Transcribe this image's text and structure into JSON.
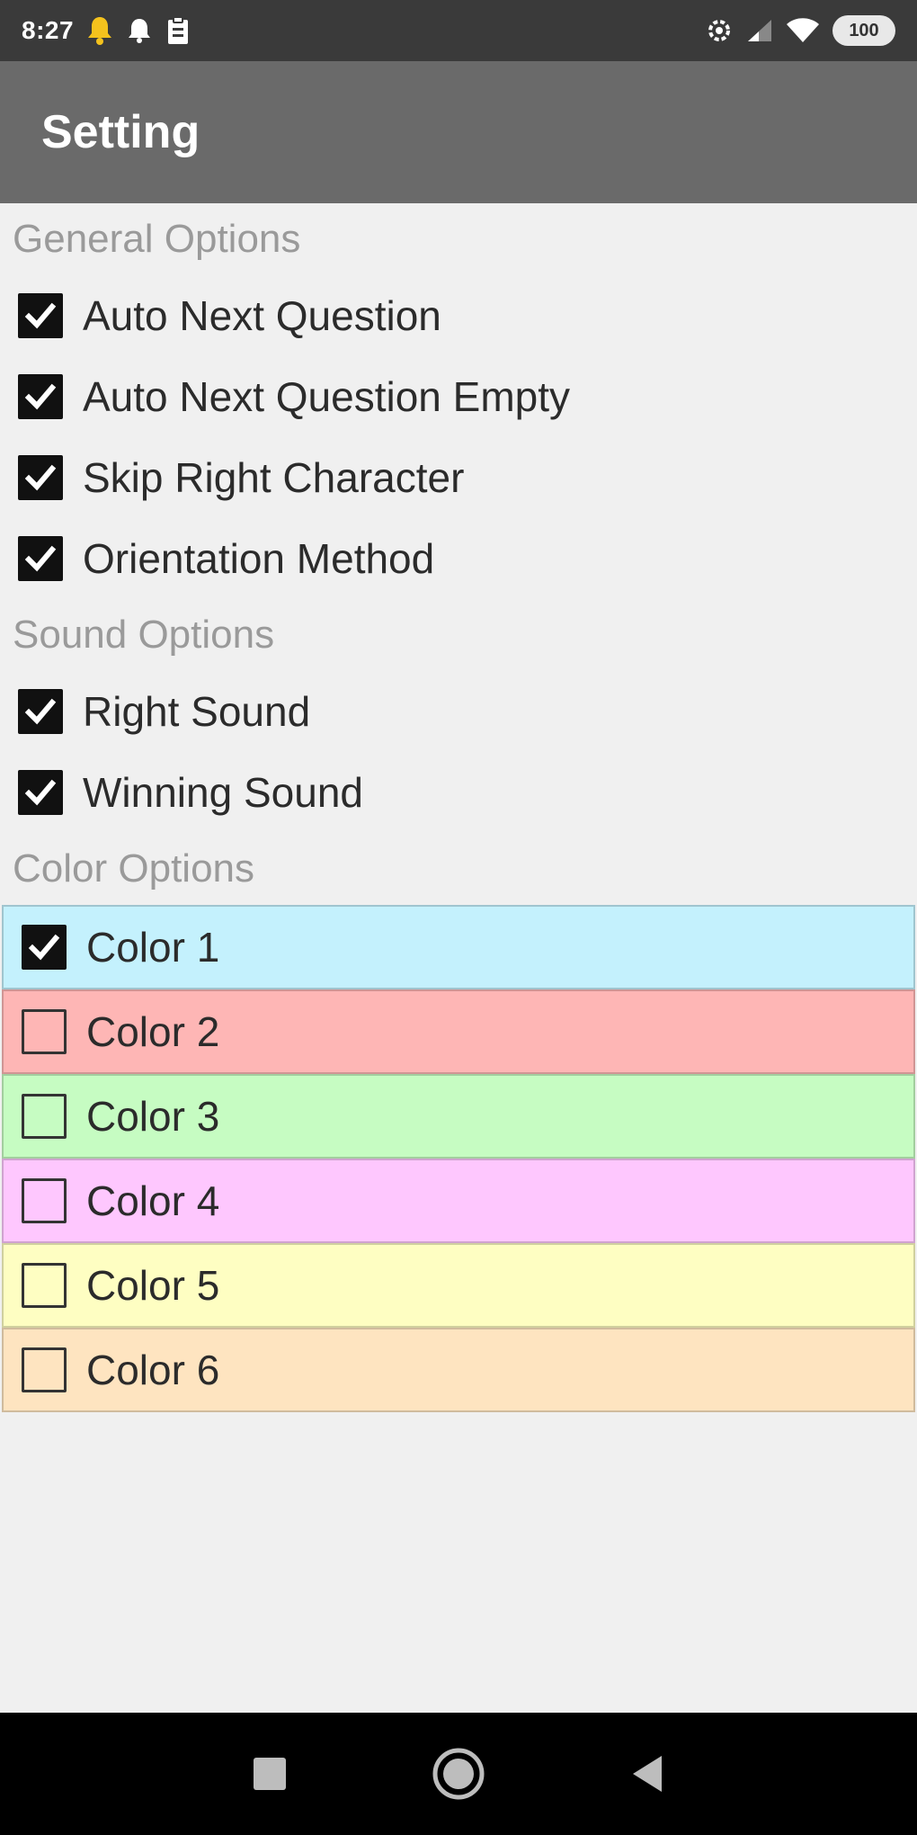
{
  "status_bar": {
    "time": "8:27",
    "battery": "100"
  },
  "app_bar": {
    "title": "Setting"
  },
  "sections": {
    "general": {
      "header": "General Options",
      "items": [
        {
          "label": "Auto Next Question",
          "checked": true
        },
        {
          "label": "Auto Next Question Empty",
          "checked": true
        },
        {
          "label": "Skip Right Character",
          "checked": true
        },
        {
          "label": "Orientation Method",
          "checked": true
        }
      ]
    },
    "sound": {
      "header": "Sound Options",
      "items": [
        {
          "label": "Right Sound",
          "checked": true
        },
        {
          "label": "Winning Sound",
          "checked": true
        }
      ]
    },
    "color": {
      "header": "Color Options",
      "items": [
        {
          "label": "Color 1",
          "checked": true,
          "bg": "#c4f1fd"
        },
        {
          "label": "Color 2",
          "checked": false,
          "bg": "#feb6b5"
        },
        {
          "label": "Color 3",
          "checked": false,
          "bg": "#c6fcc2"
        },
        {
          "label": "Color 4",
          "checked": false,
          "bg": "#fec7fe"
        },
        {
          "label": "Color 5",
          "checked": false,
          "bg": "#fefec2"
        },
        {
          "label": "Color 6",
          "checked": false,
          "bg": "#fee4c0"
        }
      ]
    }
  },
  "icons": {
    "status_left": [
      "notification-bell-icon",
      "alarm-icon",
      "clipboard-icon"
    ],
    "status_right": [
      "settings-gear-icon",
      "signal-icon",
      "wifi-icon",
      "battery-icon"
    ],
    "nav": [
      "recent-apps-icon",
      "home-icon",
      "back-icon"
    ]
  }
}
